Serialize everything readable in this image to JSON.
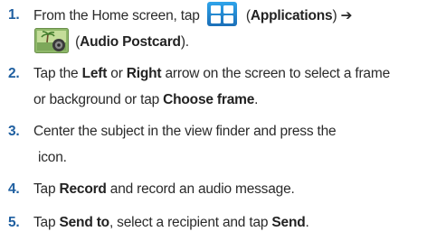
{
  "steps": [
    {
      "number": "1.",
      "line1": {
        "t1": "From the Home screen, tap ",
        "t2": " (",
        "bold1": "Applications",
        "t3": ") ➔"
      },
      "line2": {
        "t1": " (",
        "bold1": "Audio Postcard",
        "t2": ")."
      }
    },
    {
      "number": "2.",
      "line1": {
        "t1": "Tap the ",
        "bold1": "Left",
        "t2": " or ",
        "bold2": "Right",
        "t3": " arrow on the screen to select a frame"
      },
      "line2": {
        "t1": "or background or tap ",
        "bold1": "Choose frame",
        "t2": "."
      }
    },
    {
      "number": "3.",
      "line1": {
        "t1": "Center the subject in the view finder and press the"
      },
      "line2": {
        "t1": "icon."
      }
    },
    {
      "number": "4.",
      "line1": {
        "t1": "Tap ",
        "bold1": "Record",
        "t2": " and record an audio message."
      }
    },
    {
      "number": "5.",
      "line1": {
        "t1": "Tap ",
        "bold1": "Send to",
        "t2": ", select a recipient and tap ",
        "bold2": "Send",
        "t3": "."
      }
    }
  ],
  "icons": {
    "applications": "applications-grid-icon",
    "audio_postcard": "audio-postcard-icon"
  },
  "colors": {
    "step_number": "#1f5fa0",
    "applications_icon": "#1b6fb8"
  }
}
